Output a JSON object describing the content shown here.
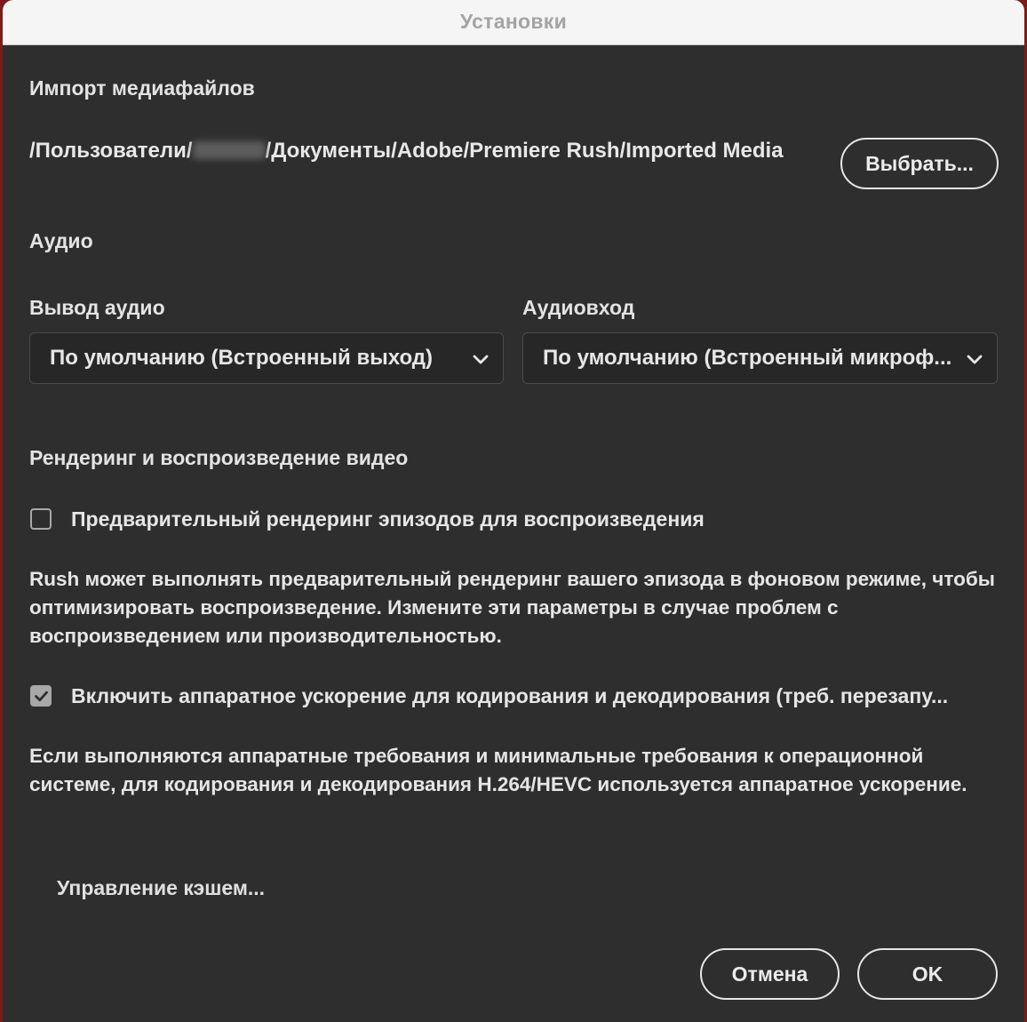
{
  "window": {
    "title": "Установки"
  },
  "import_section": {
    "heading": "Импорт медиафайлов",
    "path_prefix": "/Пользователи/",
    "path_suffix": "/Документы/Adobe/Premiere Rush/Imported Media",
    "choose_button": "Выбрать..."
  },
  "audio_section": {
    "heading": "Аудио",
    "output_label": "Вывод аудио",
    "output_value": "По умолчанию (Встроенный выход)",
    "input_label": "Аудиовход",
    "input_value": "По умолчанию (Встроенный микроф..."
  },
  "video_section": {
    "heading": "Рендеринг и воспроизведение видео",
    "prerender_label": "Предварительный рендеринг эпизодов для воспроизведения",
    "prerender_checked": false,
    "prerender_desc": "Rush может выполнять предварительный рендеринг вашего эпизода в фоновом режиме, чтобы оптимизировать воспроизведение. Измените эти параметры в случае проблем с воспроизведением или производительностью.",
    "hwaccel_label": "Включить аппаратное ускорение для кодирования и декодирования (треб. перезапу...",
    "hwaccel_checked": true,
    "hwaccel_desc": "Если выполняются аппаратные требования и минимальные требования к операционной системе, для кодирования и декодирования H.264/HEVC используется аппаратное ускорение."
  },
  "cache": {
    "manage_label": "Управление кэшем..."
  },
  "footer": {
    "cancel_label": "Отмена",
    "ok_label": "OK"
  },
  "colors": {
    "background": "#2e2e2e",
    "titlebar": "#f6f5f6",
    "text": "#e6e6e6",
    "outer": "#7a1c1c"
  },
  "icons": {
    "dropdown": "chevron-down-icon",
    "check": "checkmark-icon"
  }
}
